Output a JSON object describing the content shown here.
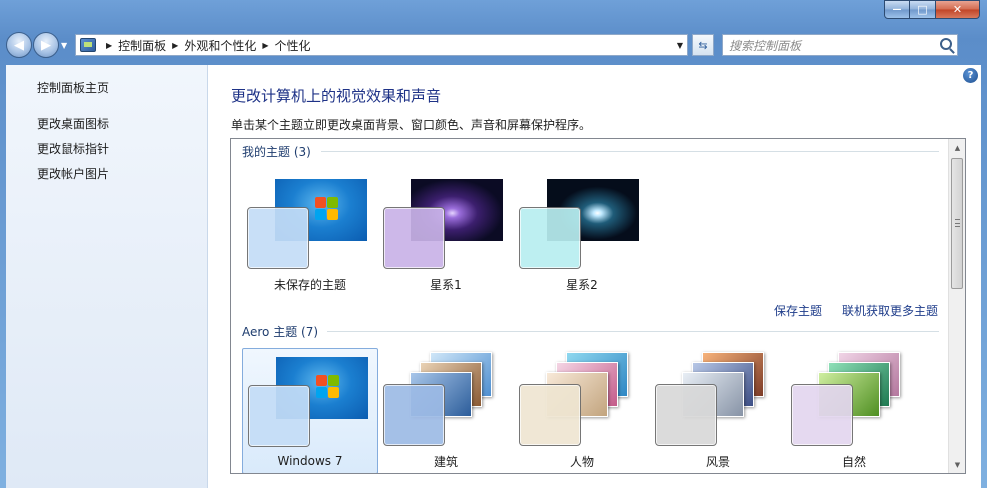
{
  "window": {
    "caption_buttons": {
      "minimize": "—",
      "maximize": "□",
      "close": "✕"
    }
  },
  "nav": {
    "back_icon": "back-arrow-icon",
    "forward_icon": "forward-arrow-icon",
    "breadcrumb": [
      "控制面板",
      "外观和个性化",
      "个性化"
    ],
    "search_placeholder": "搜索控制面板"
  },
  "sidebar": {
    "home_link": "控制面板主页",
    "links": [
      "更改桌面图标",
      "更改鼠标指针",
      "更改帐户图片"
    ]
  },
  "main": {
    "title": "更改计算机上的视觉效果和声音",
    "description": "单击某个主题立即更改桌面背景、窗口颜色、声音和屏幕保护程序。",
    "my_themes_label": "我的主题 (3)",
    "my_themes": [
      {
        "name": "未保存的主题",
        "swatch_color": "#c4ddf7"
      },
      {
        "name": "星系1",
        "swatch_color": "#c9b3e8"
      },
      {
        "name": "星系2",
        "swatch_color": "#b8eef0"
      }
    ],
    "save_theme_link": "保存主题",
    "get_more_link": "联机获取更多主题",
    "aero_themes_label": "Aero 主题 (7)",
    "aero_themes": [
      {
        "name": "Windows 7",
        "swatch_color": "#c4ddf7",
        "selected": true
      },
      {
        "name": "建筑",
        "swatch_color": "#9dbbe6",
        "selected": false
      },
      {
        "name": "人物",
        "swatch_color": "#efe6d2",
        "selected": false
      },
      {
        "name": "风景",
        "swatch_color": "#d9d9d9",
        "selected": false
      },
      {
        "name": "自然",
        "swatch_color": "#e3d6ef",
        "selected": false
      }
    ]
  },
  "colors": {
    "title_blue": "#1e3287",
    "link_blue": "#1e3c8a",
    "selection_border": "#84acdd"
  }
}
